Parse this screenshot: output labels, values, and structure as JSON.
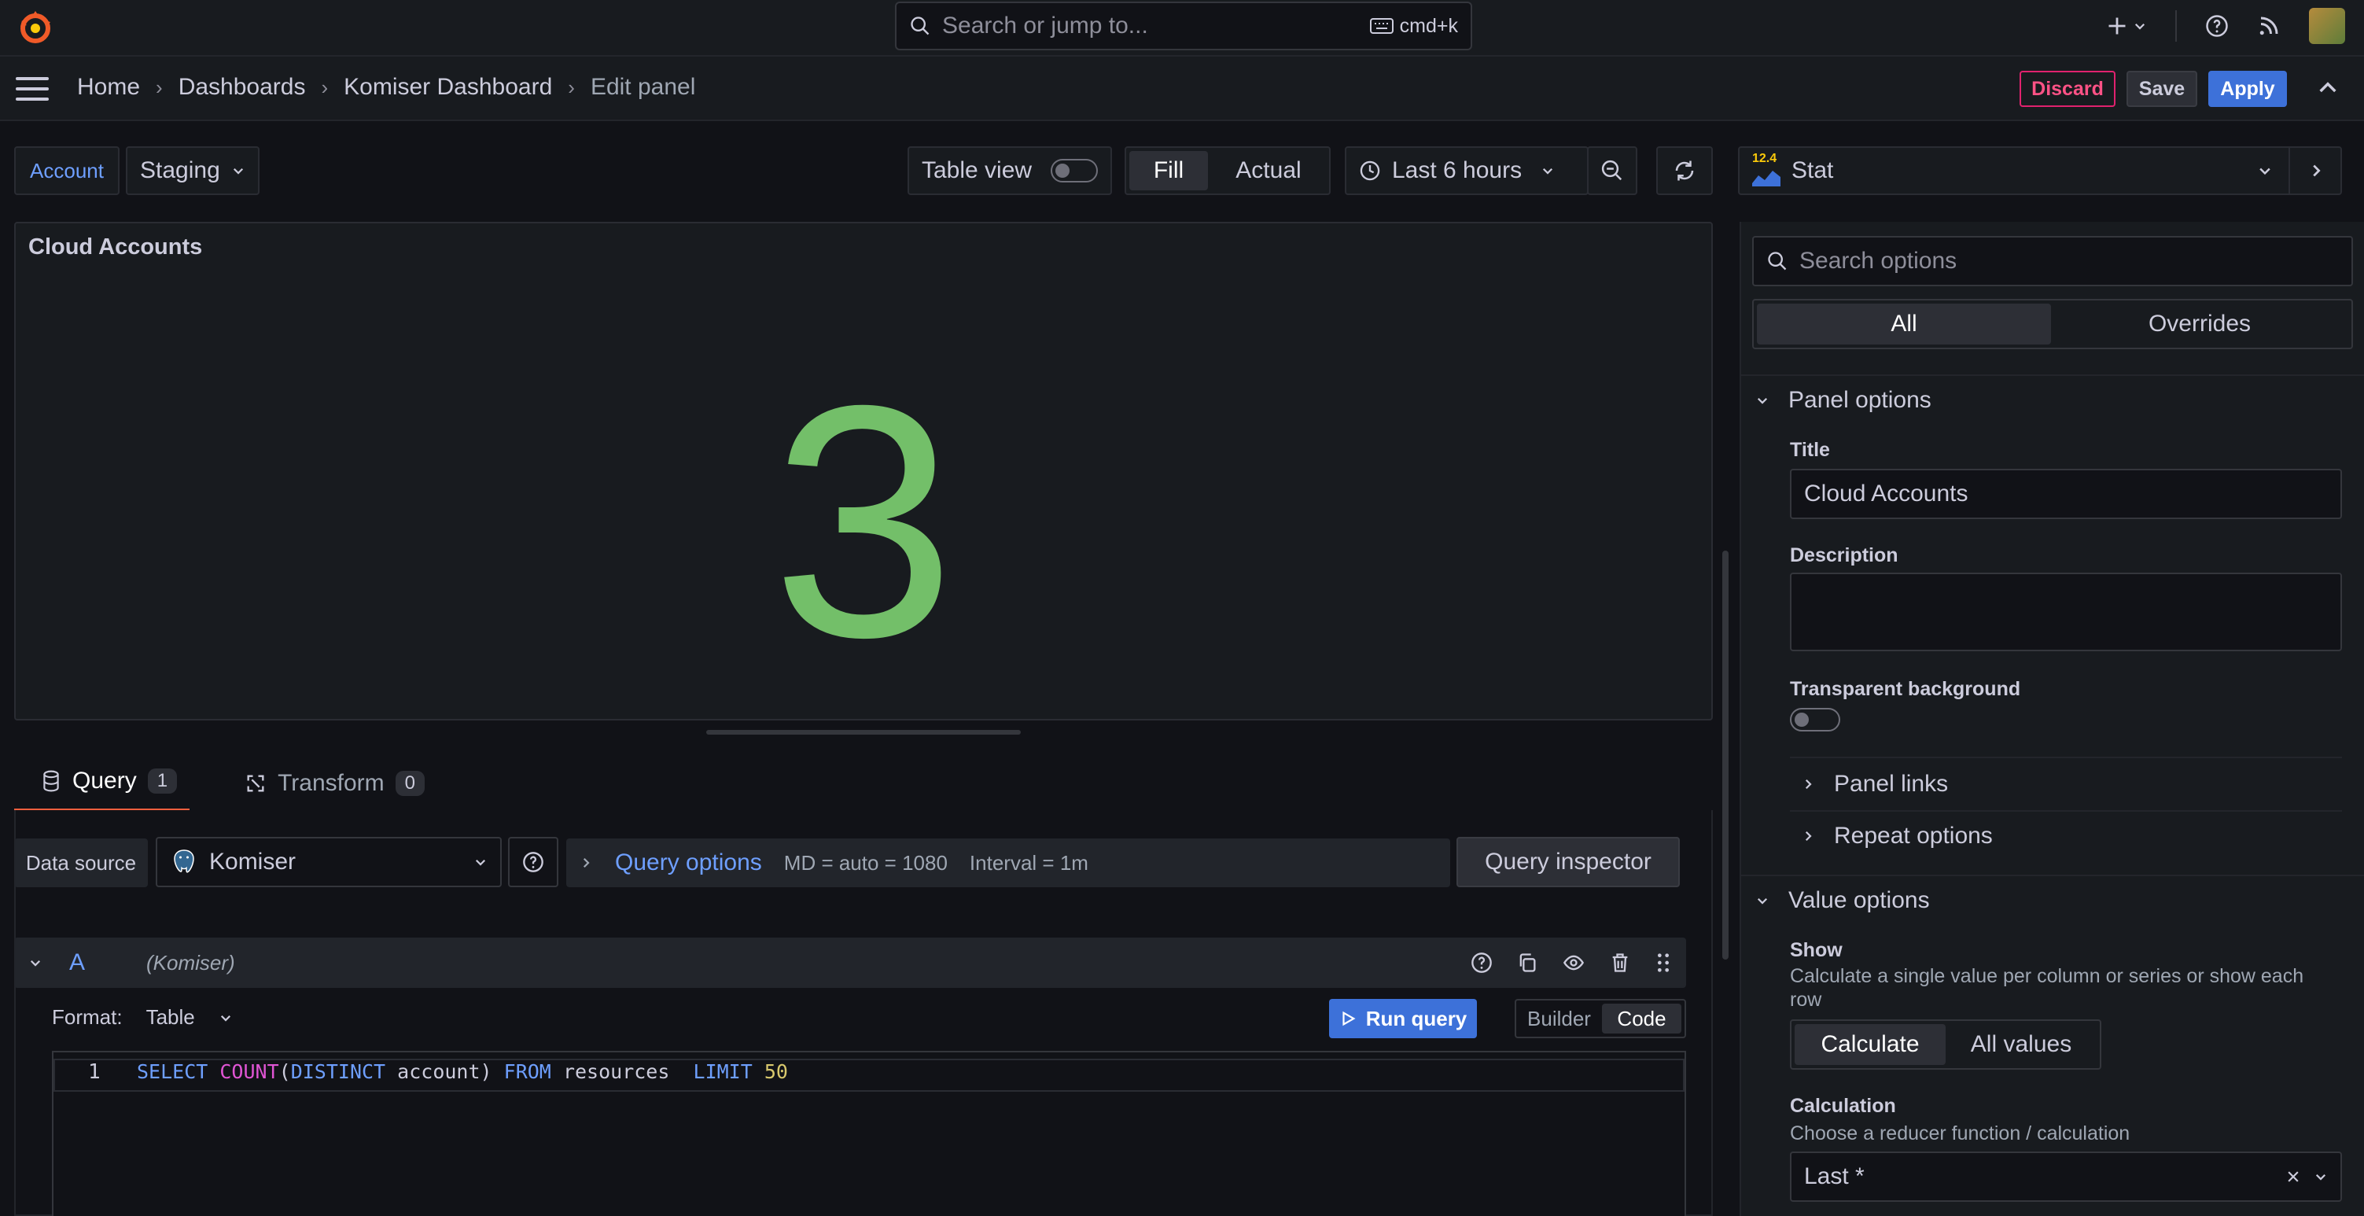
{
  "search": {
    "placeholder": "Search or jump to...",
    "shortcut": "cmd+k"
  },
  "breadcrumb": [
    "Home",
    "Dashboards",
    "Komiser Dashboard",
    "Edit panel"
  ],
  "actions": {
    "discard": "Discard",
    "save": "Save",
    "apply": "Apply"
  },
  "variables": {
    "account_label": "Account",
    "account_value": "Staging"
  },
  "toolbar": {
    "table_view": "Table view",
    "fill": "Fill",
    "actual": "Actual",
    "time_range": "Last 6 hours"
  },
  "viz": {
    "version_badge": "12.4",
    "type": "Stat"
  },
  "panel": {
    "title": "Cloud Accounts",
    "value": "3",
    "value_color": "#73bf69"
  },
  "tabs": [
    {
      "label": "Query",
      "count": "1"
    },
    {
      "label": "Transform",
      "count": "0"
    }
  ],
  "datasource": {
    "label": "Data source",
    "value": "Komiser"
  },
  "query_options": {
    "label": "Query options",
    "md": "MD = auto = 1080",
    "interval": "Interval = 1m"
  },
  "query_inspector": "Query inspector",
  "query": {
    "ref": "A",
    "ds": "(Komiser)",
    "format_label": "Format:",
    "format_value": "Table",
    "run": "Run query",
    "builder": "Builder",
    "code": "Code",
    "line_number": "1",
    "sql": {
      "select": "SELECT",
      "count": "COUNT",
      "paren_open": "(",
      "distinct": "DISTINCT",
      "column": " account)",
      "from": "FROM",
      "table": "resources",
      "limit": "LIMIT",
      "limit_value": "50"
    }
  },
  "options": {
    "search_placeholder": "Search options",
    "all": "All",
    "overrides": "Overrides",
    "panel_options": "Panel options",
    "title_label": "Title",
    "title_value": "Cloud Accounts",
    "description_label": "Description",
    "transparent_label": "Transparent background",
    "panel_links": "Panel links",
    "repeat_options": "Repeat options",
    "value_options": "Value options",
    "show_label": "Show",
    "show_desc": "Calculate a single value per column or series or show each row",
    "calculate": "Calculate",
    "all_values": "All values",
    "calculation_label": "Calculation",
    "calculation_desc": "Choose a reducer function / calculation",
    "calculation_value": "Last *"
  }
}
